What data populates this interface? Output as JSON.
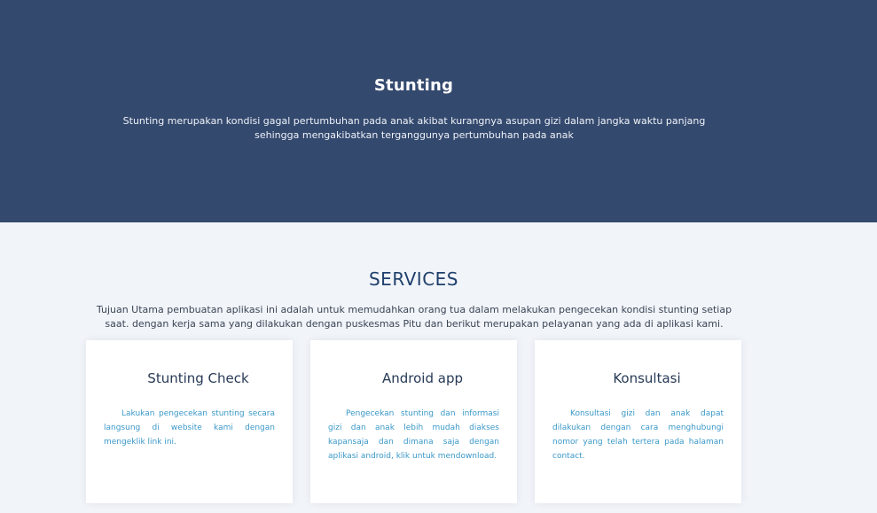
{
  "hero": {
    "title": "Stunting",
    "description": "Stunting merupakan kondisi gagal pertumbuhan pada anak akibat kurangnya asupan gizi dalam jangka waktu panjang sehingga mengakibatkan terganggunya pertumbuhan pada anak"
  },
  "services": {
    "title": "SERVICES",
    "description": "Tujuan Utama pembuatan aplikasi ini adalah untuk memudahkan orang tua dalam melakukan pengecekan kondisi stunting setiap saat. dengan kerja sama yang dilakukan dengan puskesmas Pitu dan berikut merupakan pelayanan yang ada di aplikasi kami.",
    "cards": [
      {
        "title": "Stunting Check",
        "text": "Lakukan pengecekan stunting secara langsung di website kami dengan mengeklik link ini."
      },
      {
        "title": "Android app",
        "text": "Pengecekan stunting dan informasi gizi dan anak lebih mudah diakses kapansaja dan dimana saja dengan aplikasi android, klik untuk mendownload."
      },
      {
        "title": "Konsultasi",
        "text": "Konsultasi gizi dan anak dapat dilakukan dengan cara menghubungi nomor yang telah tertera pada halaman contact."
      }
    ]
  },
  "colors": {
    "hero_bg": "#34496e",
    "page_bg": "#f1f4f9",
    "services_title": "#1f3f6b",
    "card_text": "#3a98c8"
  }
}
